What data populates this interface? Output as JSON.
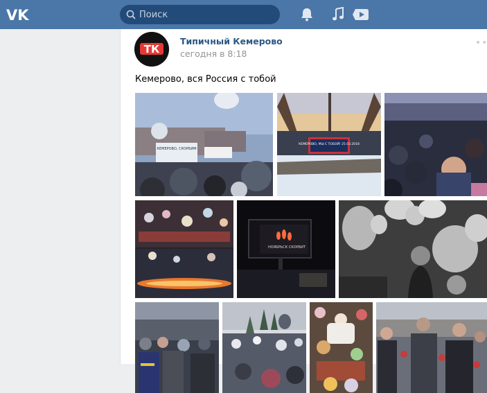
{
  "header": {
    "logo_text": "VK",
    "search_placeholder": "Поиск",
    "icons": [
      "bell-icon",
      "music-icon",
      "video-icon"
    ],
    "accent": "#4a76a8"
  },
  "post": {
    "author": "Типичный Кемерово",
    "avatar_text": "ТК",
    "time": "сегодня в 8:18",
    "text": "Кемерово, вся Россия с тобой",
    "more_icon": "more-dots-icon",
    "photos": [
      {
        "caption": "КЕМЕРОВО, СКОРБИМ"
      },
      {
        "caption": "КЕМЕРОВО, МЫ С ТОБОЙ! 25.03.2018"
      },
      {
        "caption": ""
      },
      {
        "caption": ""
      },
      {
        "caption": "НОЯБРЬСК СКОРБИТ"
      },
      {
        "caption": ""
      },
      {
        "caption": ""
      },
      {
        "caption": ""
      },
      {
        "caption": ""
      },
      {
        "caption": ""
      }
    ]
  }
}
